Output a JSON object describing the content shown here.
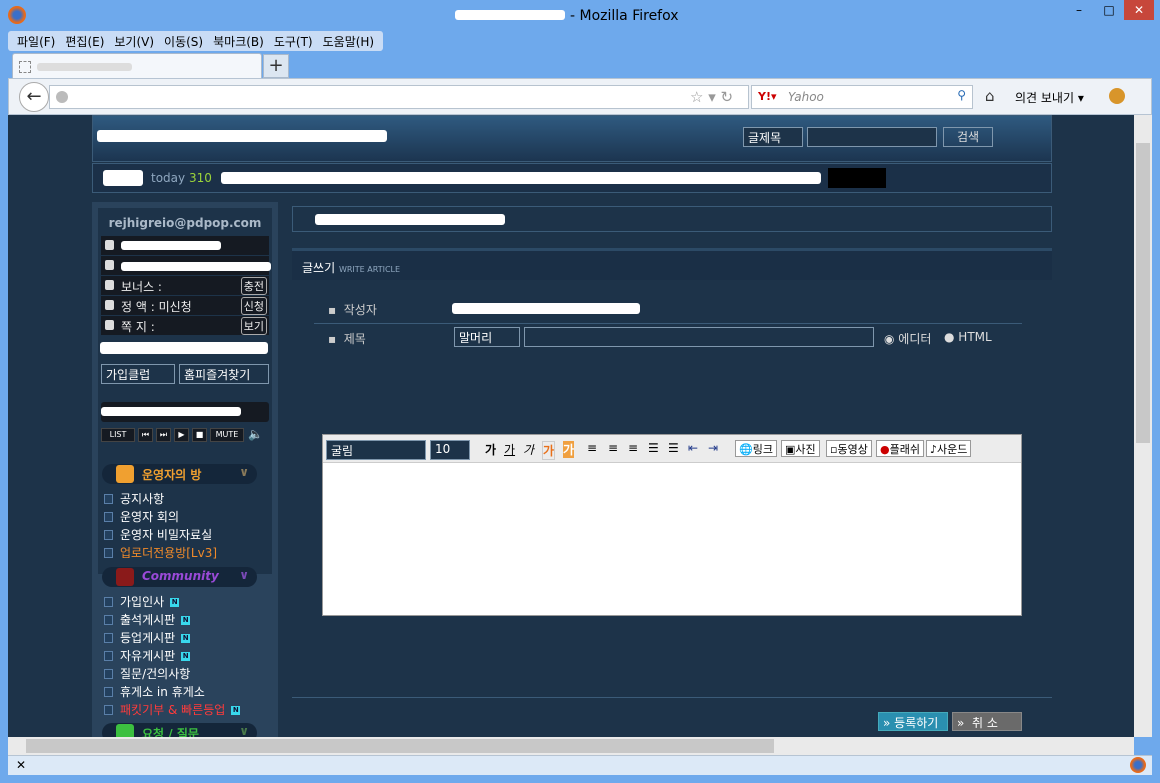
{
  "window": {
    "title": "- Mozilla Firefox",
    "min": "–",
    "max": "□",
    "close": "✕"
  },
  "menu": [
    "파일(F)",
    "편집(E)",
    "보기(V)",
    "이동(S)",
    "북마크(B)",
    "도구(T)",
    "도움말(H)"
  ],
  "tabs": {
    "new_tab": "+"
  },
  "nav": {
    "search_placeholder": "Yahoo",
    "feedback": "의견 보내기 ▾"
  },
  "header": {
    "search_select": "글제목",
    "search_button": "검색"
  },
  "info": {
    "today_label": "today",
    "today_count": "310"
  },
  "sidebar": {
    "email": "rejhigreio@pdpop.com",
    "rows": [
      {
        "label": "보너스 :",
        "btn": "충전"
      },
      {
        "label": "정 액 : 미신청",
        "btn": "신청"
      },
      {
        "label": "쪽 지 :",
        "btn": "보기"
      }
    ],
    "row2_btn": "충전",
    "join_club": "가입클럽",
    "favorites": "홈피즐겨찾기",
    "player": [
      "LIST",
      "⏮",
      "⏭",
      "▶",
      "■",
      "MUTE"
    ],
    "categories": [
      {
        "title": "운영자의 방",
        "color": "#f0a030",
        "items": [
          {
            "label": "공지사항"
          },
          {
            "label": "운영자 회의"
          },
          {
            "label": "운영자 비밀자료실"
          },
          {
            "label": "업로더전용방[Lv3]",
            "color": "#f08a2a"
          }
        ]
      },
      {
        "title": "Community",
        "color": "#9a4ad8",
        "items": [
          {
            "label": "가입인사",
            "new": "N"
          },
          {
            "label": "출석게시판",
            "new": "N"
          },
          {
            "label": "등업게시판",
            "new": "N"
          },
          {
            "label": "자유게시판",
            "new": "N"
          },
          {
            "label": "질문/건의사항"
          },
          {
            "label": "휴게소 in 휴게소"
          },
          {
            "label": "패킷기부 & 빠른등업",
            "color": "#ff3b3b",
            "new": "N"
          }
        ]
      },
      {
        "title": "요청 / 질문",
        "color": "#3cc040"
      }
    ]
  },
  "main": {
    "write_title": "글쓰기",
    "write_sub": "WRITE ARTICLE",
    "author_label": "작성자",
    "subject_label": "제목",
    "prefix_select": "말머리",
    "mode_editor": "에디터",
    "mode_html": "HTML",
    "font_select": "굴림",
    "size_select": "10",
    "tools": [
      "링크",
      "사진",
      "동영상",
      "플래쉬",
      "♪사운드"
    ],
    "submit": "등록하기",
    "cancel": "취 소"
  }
}
